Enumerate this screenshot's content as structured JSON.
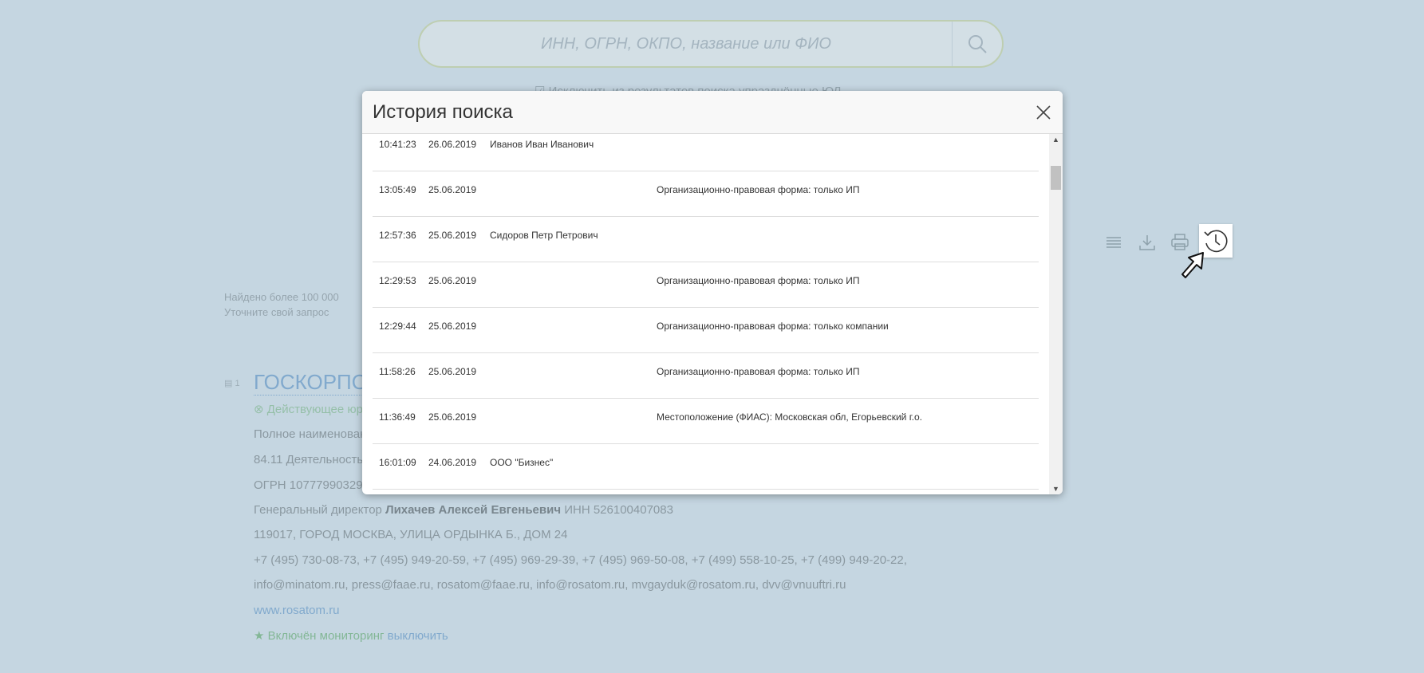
{
  "search": {
    "placeholder": "ИНН, ОГРН, ОКПО, название или ФИО",
    "exclude_checkbox_label": "☑ Исключить из результатов поиска упразднённые ЮЛ"
  },
  "results_summary": {
    "found": "Найдено более 100 000",
    "refine": "Уточните свой запрос"
  },
  "result": {
    "number": "1",
    "title": "ГОСКОРПО",
    "status": "Действующее юр",
    "lines": [
      "Полное наименован",
      "84.11 Деятельность",
      "ОГРН 10777990329"
    ],
    "director_prefix": "Генеральный директор",
    "director_name": "Лихачев Алексей Евгеньевич",
    "director_inn": "ИНН 526100407083",
    "address": "119017, ГОРОД МОСКВА, УЛИЦА ОРДЫНКА Б., ДОМ 24",
    "phones": "+7 (495) 730-08-73, +7 (495) 949-20-59, +7 (495) 969-29-39, +7 (495) 969-50-08, +7 (499) 558-10-25, +7 (499) 949-20-22,",
    "emails": "info@minatom.ru, press@faae.ru, rosatom@faae.ru, info@rosatom.ru, mvgayduk@rosatom.ru, dvv@vnuuftri.ru",
    "website": "www.rosatom.ru",
    "monitoring_on": "★ Включён мониторинг",
    "monitoring_off": "выключить"
  },
  "toolbar": {
    "icons": [
      "list-icon",
      "download-icon",
      "print-icon",
      "history-icon"
    ]
  },
  "modal": {
    "title": "История поиска",
    "rows": [
      {
        "time": "10:41:23",
        "date": "26.06.2019",
        "query": "Иванов Иван Иванович",
        "filter": ""
      },
      {
        "time": "13:05:49",
        "date": "25.06.2019",
        "query": "",
        "filter": "Организационно-правовая форма: только ИП"
      },
      {
        "time": "12:57:36",
        "date": "25.06.2019",
        "query": "Сидоров Петр Петрович",
        "filter": ""
      },
      {
        "time": "12:29:53",
        "date": "25.06.2019",
        "query": "",
        "filter": "Организационно-правовая форма: только ИП"
      },
      {
        "time": "12:29:44",
        "date": "25.06.2019",
        "query": "",
        "filter": "Организационно-правовая форма: только компании"
      },
      {
        "time": "11:58:26",
        "date": "25.06.2019",
        "query": "",
        "filter": "Организационно-правовая форма: только ИП"
      },
      {
        "time": "11:36:49",
        "date": "25.06.2019",
        "query": "",
        "filter": "Местоположение (ФИАС): Московская обл, Егорьевский г.о."
      },
      {
        "time": "16:01:09",
        "date": "24.06.2019",
        "query": "ООО \"Бизнес\"",
        "filter": ""
      }
    ]
  },
  "colors": {
    "page_bg": "#c5d6e1",
    "link": "#4a86bd",
    "monitor": "#4e9e59"
  }
}
